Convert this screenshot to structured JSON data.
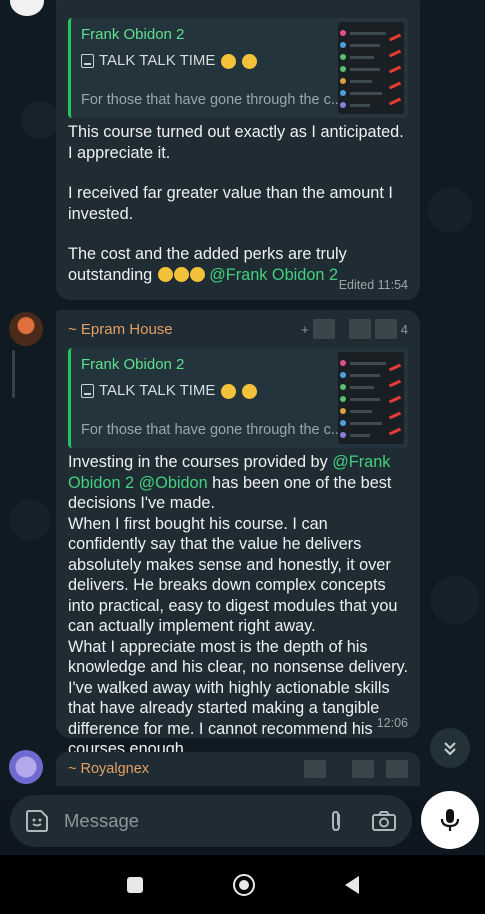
{
  "messages": [
    {
      "reply": {
        "author": "Frank Obidon 2",
        "title": "TALK TALK TIME",
        "preview": "For those that have gone through the c..."
      },
      "paragraphs": [
        "This course turned out exactly as I anticipated. I appreciate it.",
        "I received far greater value than the amount I invested."
      ],
      "last_text": "The cost and the added perks are truly outstanding",
      "last_mention": "@Frank Obidon 2",
      "edited_label": "Edited",
      "time": "11:54"
    },
    {
      "sender": "~ Epram House",
      "sender_extra": "4",
      "reply": {
        "author": "Frank Obidon 2",
        "title": "TALK TALK TIME",
        "preview": "For those that have gone through the c..."
      },
      "intro_before": "Investing in the courses provided by ",
      "mention1": "@Frank Obidon 2",
      "mention2": "@Obidon",
      "intro_after": " has been one of the best decisions I've made.",
      "body1": "When I first bought his course. I can confidently say that the value he delivers absolutely makes sense and honestly, it over delivers. He breaks down complex concepts into practical, easy to digest modules that you can actually implement right away.",
      "body2": "What I appreciate most is the depth of his knowledge and his clear, no nonsense delivery. I've walked away with highly actionable skills that have already started making a tangible difference for me. I cannot recommend his courses enough",
      "time": "12:06"
    }
  ],
  "preview_sender": "~ Royalgnex",
  "input": {
    "placeholder": "Message"
  },
  "icons": {
    "sticker": "sticker-icon",
    "attach": "paperclip-icon",
    "camera": "camera-icon",
    "mic": "microphone-icon",
    "scroll": "double-chevron-down-icon"
  },
  "colors": {
    "mention": "#44d07d",
    "reply_accent": "#23c55e",
    "sender_name": "#e4a064",
    "bubble": "#1f2c33"
  }
}
